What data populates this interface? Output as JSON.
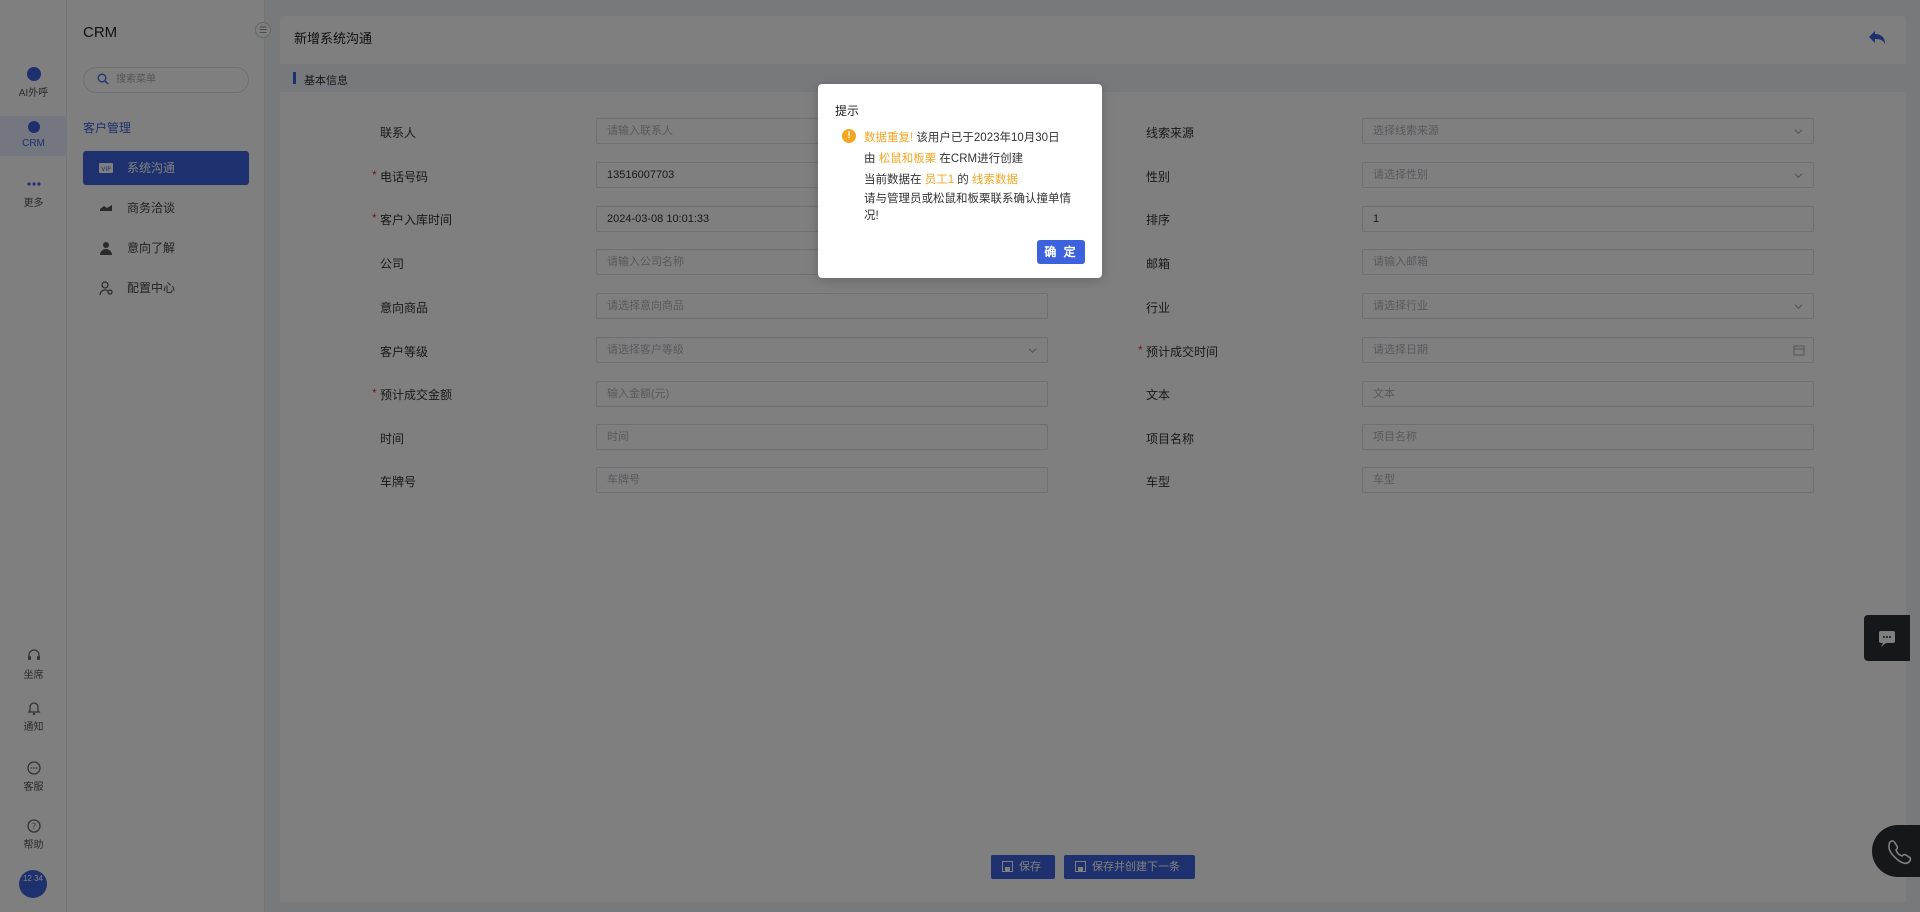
{
  "rail": {
    "items": [
      {
        "label": "AI外呼",
        "icon": "ai-icon"
      },
      {
        "label": "CRM",
        "icon": "crm-icon"
      },
      {
        "label": "更多",
        "icon": "more-icon"
      },
      {
        "label": "坐席",
        "icon": "headset-icon"
      },
      {
        "label": "通知",
        "icon": "bell-icon"
      },
      {
        "label": "客服",
        "icon": "chat-icon"
      },
      {
        "label": "帮助",
        "icon": "help-icon"
      }
    ],
    "avatar_text": "12 34"
  },
  "sidebar": {
    "title": "CRM",
    "search_placeholder": "搜索菜单",
    "group": "客户管理",
    "items": [
      {
        "label": "系统沟通",
        "icon": "vip-icon"
      },
      {
        "label": "商务洽谈",
        "icon": "handshake-icon"
      },
      {
        "label": "意向了解",
        "icon": "user-icon"
      },
      {
        "label": "配置中心",
        "icon": "user-settings-icon"
      }
    ]
  },
  "header": {
    "title": "新增系统沟通"
  },
  "section": {
    "label": "基本信息"
  },
  "form": {
    "left": [
      {
        "label": "联系人",
        "required": false,
        "value": "",
        "placeholder": "请输入联系人"
      },
      {
        "label": "电话号码",
        "required": true,
        "value": "13516007703",
        "placeholder": ""
      },
      {
        "label": "客户入库时间",
        "required": true,
        "value": "2024-03-08 10:01:33",
        "placeholder": ""
      },
      {
        "label": "公司",
        "required": false,
        "value": "",
        "placeholder": "请输入公司名称"
      },
      {
        "label": "意向商品",
        "required": false,
        "value": "",
        "placeholder": "请选择意向商品"
      },
      {
        "label": "客户等级",
        "required": false,
        "value": "",
        "placeholder": "请选择客户等级"
      },
      {
        "label": "预计成交金额",
        "required": true,
        "value": "",
        "placeholder": "输入金额(元)"
      },
      {
        "label": "时间",
        "required": false,
        "value": "",
        "placeholder": "时间"
      },
      {
        "label": "车牌号",
        "required": false,
        "value": "",
        "placeholder": "车牌号"
      }
    ],
    "right": [
      {
        "label": "线索来源",
        "required": false,
        "value": "",
        "placeholder": "选择线索来源"
      },
      {
        "label": "性别",
        "required": false,
        "value": "",
        "placeholder": "请选择性别"
      },
      {
        "label": "排序",
        "required": false,
        "value": "1",
        "placeholder": ""
      },
      {
        "label": "邮箱",
        "required": false,
        "value": "",
        "placeholder": "请输入邮箱"
      },
      {
        "label": "行业",
        "required": false,
        "value": "",
        "placeholder": "请选择行业"
      },
      {
        "label": "预计成交时间",
        "required": true,
        "value": "",
        "placeholder": "请选择日期"
      },
      {
        "label": "文本",
        "required": false,
        "value": "",
        "placeholder": "文本"
      },
      {
        "label": "项目名称",
        "required": false,
        "value": "",
        "placeholder": "项目名称"
      },
      {
        "label": "车型",
        "required": false,
        "value": "",
        "placeholder": "车型"
      }
    ]
  },
  "buttons": {
    "save": "保存",
    "save_next": "保存并创建下一条"
  },
  "modal": {
    "title": "提示",
    "warning_icon": "!",
    "dup_label": "数据重复!",
    "line1_rest": " 该用户已于2023年10月30日",
    "line2_pre": "由 ",
    "line2_name": "松鼠和板栗",
    "line2_rest": " 在CRM进行创建",
    "line3_pre": "当前数据在 ",
    "line3_emp": "员工1",
    "line3_mid": " 的 ",
    "line3_data": "线索数据",
    "line4": "请与管理员或松鼠和板栗联系确认撞单情况!",
    "ok": "确 定"
  },
  "colors": {
    "accent": "#3c63dd",
    "warning": "#f5a623",
    "required": "#e23b3b"
  }
}
